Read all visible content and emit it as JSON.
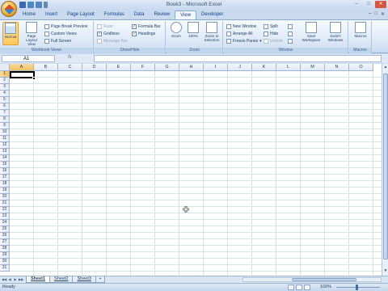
{
  "window": {
    "title": "Book3 - Microsoft Excel"
  },
  "tabs": [
    "Home",
    "Insert",
    "Page Layout",
    "Formulas",
    "Data",
    "Review",
    "View",
    "Developer"
  ],
  "active_tab": "View",
  "ribbon": {
    "workbook_views": {
      "label": "Workbook Views",
      "normal": "Normal",
      "page_layout": "Page Layout View",
      "page_break_preview": "Page Break Preview",
      "custom_views": "Custom Views",
      "full_screen": "Full Screen"
    },
    "show_hide": {
      "label": "Show/Hide",
      "ruler": "Ruler",
      "gridlines": "Gridlines",
      "message_bar": "Message Bar",
      "formula_bar": "Formula Bar",
      "headings": "Headings"
    },
    "zoom": {
      "label": "Zoom",
      "zoom": "Zoom",
      "hundred": "100%",
      "zoom_to_selection": "Zoom to Selection"
    },
    "window": {
      "label": "Window",
      "new_window": "New Window",
      "arrange_all": "Arrange All",
      "freeze_panes": "Freeze Panes",
      "split": "Split",
      "hide": "Hide",
      "unhide": "Unhide",
      "save_workspace": "Save Workspace",
      "switch_windows": "Switch Windows"
    },
    "macros": {
      "label": "Macros",
      "macros": "Macros"
    }
  },
  "formula_bar": {
    "name_box": "A1",
    "fx": "fx",
    "value": ""
  },
  "grid": {
    "columns": [
      "A",
      "B",
      "C",
      "D",
      "E",
      "F",
      "G",
      "H",
      "I",
      "J",
      "K",
      "L",
      "M",
      "N",
      "O"
    ],
    "rows": [
      "1",
      "2",
      "3",
      "4",
      "5",
      "6",
      "7",
      "8",
      "9",
      "10",
      "11",
      "12",
      "13",
      "14",
      "15",
      "16",
      "17",
      "18",
      "19",
      "20",
      "21",
      "22",
      "23",
      "24",
      "25",
      "26",
      "27",
      "28",
      "29",
      "30",
      "31"
    ],
    "active_cell": "A1"
  },
  "sheets": [
    "Sheet1",
    "Sheet2",
    "Sheet3"
  ],
  "active_sheet": "Sheet1",
  "status": {
    "text": "Ready",
    "zoom": "100%"
  },
  "colors": {
    "ribbon_bg": "#dbe7f6",
    "active_highlight": "#ffc758",
    "grid_line": "#d9e1ec"
  }
}
